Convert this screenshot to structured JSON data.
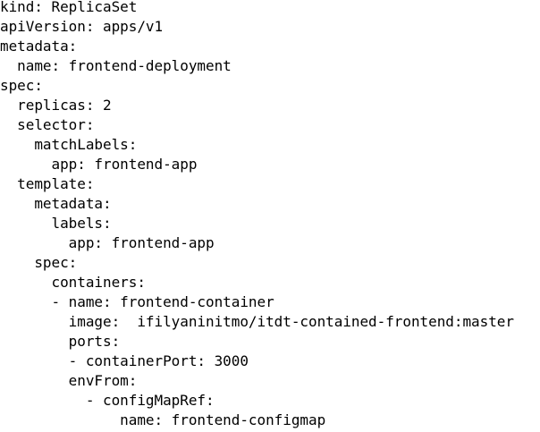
{
  "document": {
    "lines": [
      "kind: ReplicaSet",
      "apiVersion: apps/v1",
      "metadata:",
      "  name: frontend-deployment",
      "spec:",
      "  replicas: 2",
      "  selector:",
      "    matchLabels:",
      "      app: frontend-app",
      "  template:",
      "    metadata:",
      "      labels:",
      "        app: frontend-app",
      "    spec:",
      "      containers:",
      "      - name: frontend-container",
      "        image:  ifilyaninitmo/itdt-contained-frontend:master",
      "        ports:",
      "        - containerPort: 3000",
      "        envFrom:",
      "          - configMapRef:",
      "              name: frontend-configmap"
    ]
  }
}
